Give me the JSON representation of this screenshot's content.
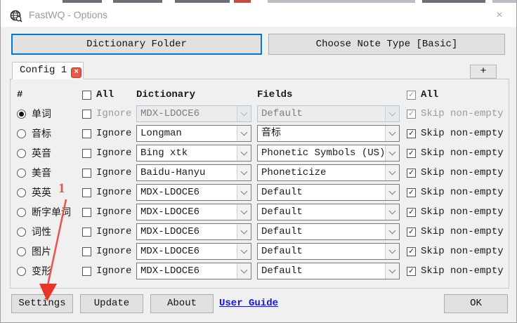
{
  "window": {
    "title": "FastWQ - Options",
    "close_glyph": "×"
  },
  "top_buttons": {
    "dictionary_folder": "Dictionary Folder",
    "choose_note_type": "Choose Note Type [Basic]"
  },
  "tabs": {
    "config_label": "Config 1",
    "close_glyph": "×",
    "add_label": "+"
  },
  "table": {
    "headers": {
      "num": "#",
      "all_left": "All",
      "dictionary": "Dictionary",
      "fields": "Fields",
      "all_right": "All"
    },
    "all_left_checked": false,
    "all_right_checked": true,
    "ignore_label": "Ignore",
    "skip_label": "Skip non-empty",
    "check_glyph": "✓",
    "rows": [
      {
        "label": "单词",
        "dictionary": "MDX-LDOCE6",
        "field": "Default",
        "selected": true,
        "disabled": true,
        "ignore": false,
        "skip": true
      },
      {
        "label": "音标",
        "dictionary": "Longman",
        "field": "音标",
        "selected": false,
        "disabled": false,
        "ignore": false,
        "skip": true
      },
      {
        "label": "英音",
        "dictionary": "Bing xtk",
        "field": "Phonetic Symbols (US)",
        "selected": false,
        "disabled": false,
        "ignore": false,
        "skip": true
      },
      {
        "label": "美音",
        "dictionary": "Baidu-Hanyu",
        "field": "Phoneticize",
        "selected": false,
        "disabled": false,
        "ignore": false,
        "skip": true
      },
      {
        "label": "英英",
        "dictionary": "MDX-LDOCE6",
        "field": "Default",
        "selected": false,
        "disabled": false,
        "ignore": false,
        "skip": true
      },
      {
        "label": "断字单词",
        "dictionary": "MDX-LDOCE6",
        "field": "Default",
        "selected": false,
        "disabled": false,
        "ignore": false,
        "skip": true
      },
      {
        "label": "词性",
        "dictionary": "MDX-LDOCE6",
        "field": "Default",
        "selected": false,
        "disabled": false,
        "ignore": false,
        "skip": true
      },
      {
        "label": "图片",
        "dictionary": "MDX-LDOCE6",
        "field": "Default",
        "selected": false,
        "disabled": false,
        "ignore": false,
        "skip": true
      },
      {
        "label": "变形",
        "dictionary": "MDX-LDOCE6",
        "field": "Default",
        "selected": false,
        "disabled": false,
        "ignore": false,
        "skip": true
      }
    ]
  },
  "footer": {
    "settings": "Settings",
    "update": "Update",
    "about": "About",
    "user_guide": "User Guide",
    "ok": "OK"
  },
  "annotation": {
    "number": "1",
    "color": "#e8544a"
  }
}
